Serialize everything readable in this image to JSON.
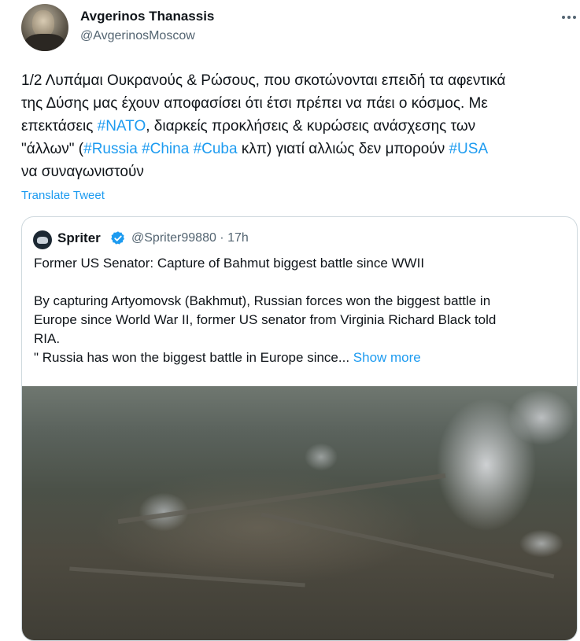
{
  "author": {
    "display_name": "Avgerinos Thanassis",
    "handle": "@AvgerinosMoscow",
    "avatar_icon": "profile-photo"
  },
  "tweet": {
    "lines": [
      [
        {
          "t": "1/2 Λυπάμαι Ουκρανούς & Ρώσους, που σκοτώνονται επειδή τα αφεντικά"
        }
      ],
      [
        {
          "t": "της Δύσης μας έχουν αποφασίσει ότι έτσι πρέπει να πάει ο κόσμος. Με"
        }
      ],
      [
        {
          "t": "επεκτάσεις "
        },
        {
          "t": "#NATO",
          "tag": true
        },
        {
          "t": ", διαρκείς προκλήσεις & κυρώσεις ανάσχεσης των"
        }
      ],
      [
        {
          "t": "\"άλλων\" ("
        },
        {
          "t": "#Russia",
          "tag": true
        },
        {
          "t": " "
        },
        {
          "t": "#China",
          "tag": true
        },
        {
          "t": " "
        },
        {
          "t": "#Cuba",
          "tag": true
        },
        {
          "t": " κλπ) γιατί αλλιώς δεν μπορούν "
        },
        {
          "t": "#USA",
          "tag": true
        }
      ],
      [
        {
          "t": "να συναγωνιστούν"
        }
      ]
    ],
    "translate_label": "Translate Tweet"
  },
  "quoted": {
    "name": "Spriter",
    "handle_time": "@Spriter99880 · 17h",
    "verified": true,
    "lines": [
      "Former US Senator: Capture of Bahmut biggest battle since WWII",
      "",
      " By capturing Artyomovsk (Bakhmut), Russian forces won the biggest battle in",
      "Europe since World War II, former US senator from Virginia Richard Black told",
      "RIA.",
      "\" Russia has won the biggest battle in Europe since..."
    ],
    "show_more_label": "Show more",
    "image_icon": "aerial-city-photo"
  },
  "colors": {
    "accent": "#1d9bf0",
    "text": "#0f1419",
    "secondary": "#536471",
    "border": "#cfd9de"
  }
}
